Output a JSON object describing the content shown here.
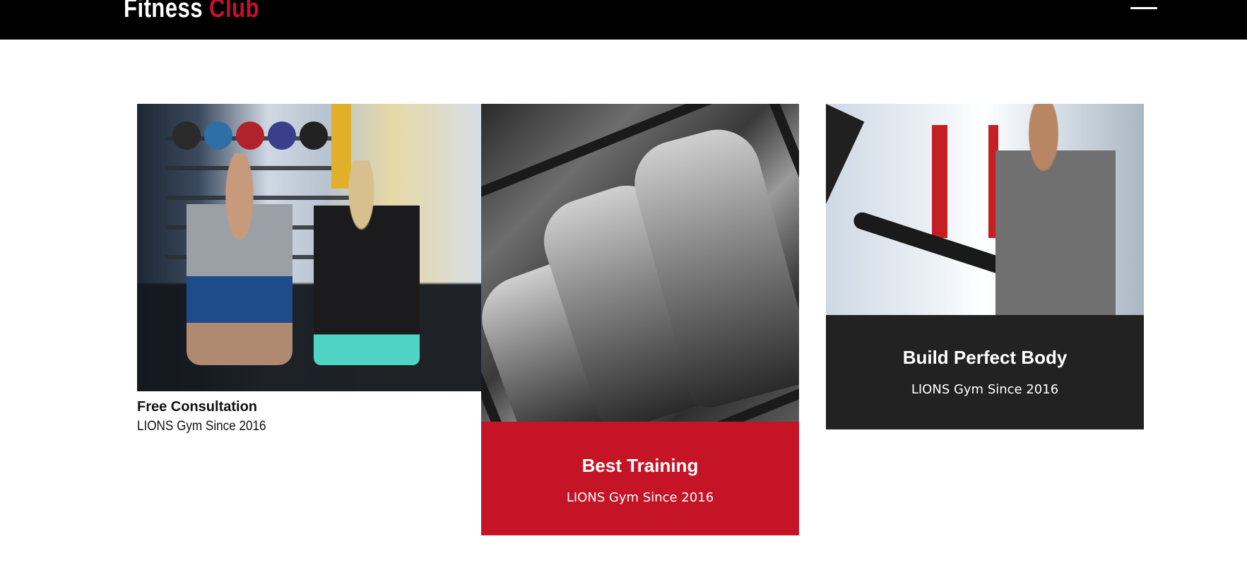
{
  "header": {
    "brand_word1": "Fitness",
    "brand_word2": "Club",
    "menu_icon": "hamburger-menu-icon"
  },
  "colors": {
    "header_bg": "#000000",
    "accent_red": "#c41426",
    "dark_panel": "#222222"
  },
  "cards": [
    {
      "image": "trainer-assisting-woman-with-dumbbell-photo",
      "title": "Free Consultation",
      "subtitle": "LIONS Gym Since 2016"
    },
    {
      "image": "men-posing-flexing-in-mirror-bw-photo",
      "title": "Best Training",
      "subtitle": "LIONS Gym Since 2016"
    },
    {
      "image": "man-running-on-treadmill-photo",
      "title": "Build Perfect Body",
      "subtitle": "LIONS Gym Since 2016"
    }
  ]
}
